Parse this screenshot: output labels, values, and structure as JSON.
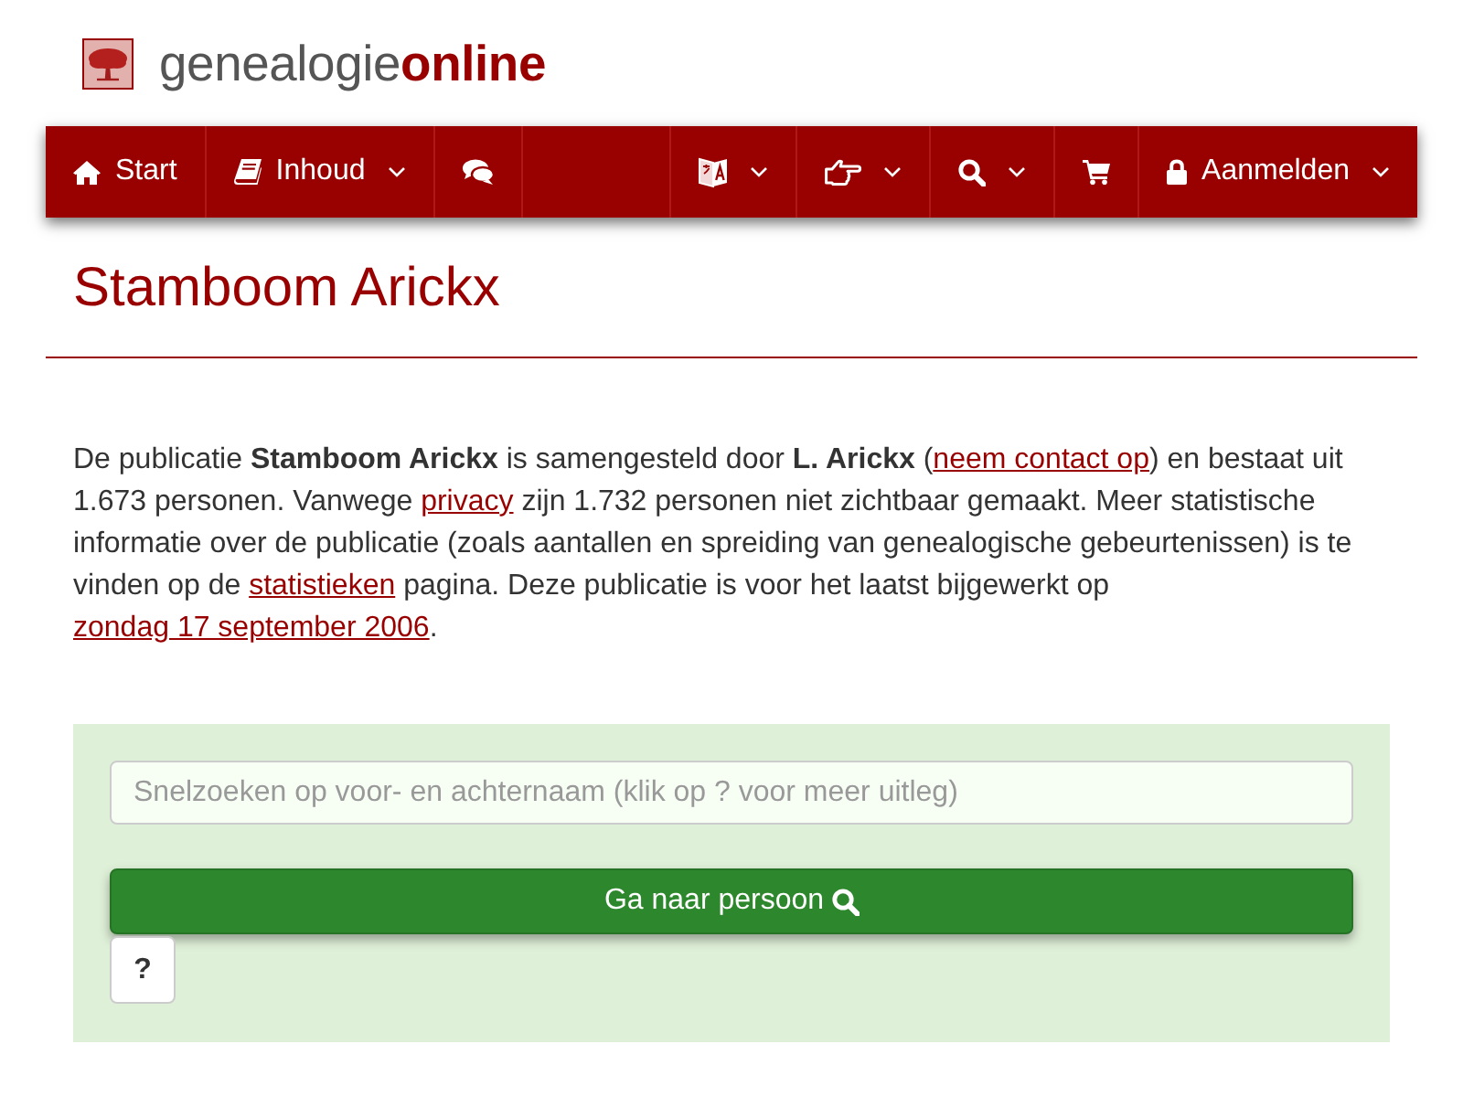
{
  "logo": {
    "text": "genealogie**online**"
  },
  "navbar": {
    "left_items": [
      {
        "label": "Start",
        "has_menu": false
      },
      {
        "label": "Inhoud",
        "has_menu": true
      },
      {
        "has_menu": false
      }
    ],
    "right_items": [
      {
        "has_menu": true
      },
      {
        "has_menu": true
      },
      {
        "has_menu": true
      },
      {
        "has_menu": false
      },
      {
        "label": "Aanmelden",
        "has_menu": true
      }
    ]
  },
  "page": {
    "title": "Stamboom Arickx",
    "intro": [
      {
        "kind": "text",
        "text": "De publicatie **Stamboom Arickx** is samengesteld door **L. Arickx** ("
      },
      {
        "kind": "link",
        "text": "neem contact op"
      },
      {
        "kind": "text",
        "text": ") en bestaat uit 1.673 personen. Vanwege "
      },
      {
        "kind": "link",
        "text": "privacy"
      },
      {
        "kind": "text",
        "text": " zijn 1.732 personen niet zichtbaar gemaakt. Meer statistische informatie over de publicatie (zoals aantallen en spreiding van genealogische gebeurtenissen) is te vinden op de "
      },
      {
        "kind": "link",
        "text": "statistieken"
      },
      {
        "kind": "text",
        "text": " pagina. Deze publicatie is voor het laatst bijgewerkt op "
      },
      {
        "kind": "link",
        "text": "zondag 17 september 2006"
      },
      {
        "kind": "text",
        "text": "."
      }
    ]
  },
  "quick_search": {
    "placeholder": "Snelzoeken op voor- en achternaam (klik op ? voor meer uitleg)",
    "submit_label": "Ga naar persoon",
    "help_label": "?"
  }
}
